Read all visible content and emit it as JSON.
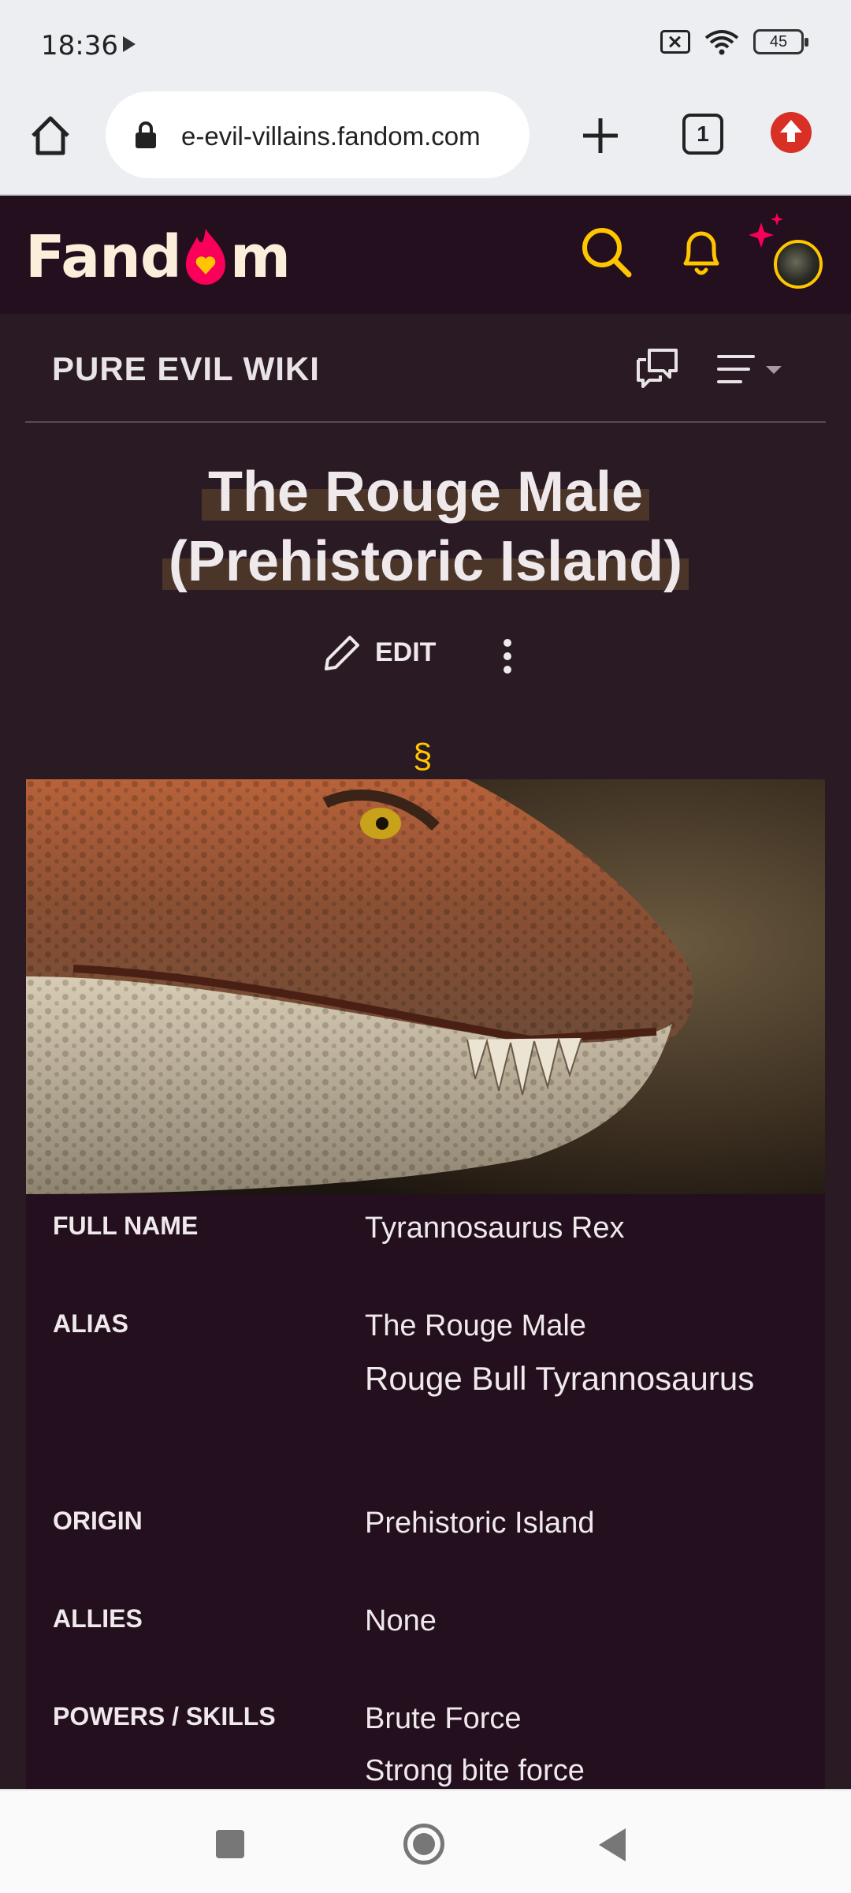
{
  "status_bar": {
    "time": "18:36",
    "battery": "45"
  },
  "browser": {
    "url": "e-evil-villains.fandom.com",
    "tab_count": "1"
  },
  "header": {
    "logo_text_left": "Fand",
    "logo_text_right": "m"
  },
  "wiki": {
    "name": "PURE EVIL WIKI"
  },
  "article": {
    "title_line1": "The Rouge Male",
    "title_line2": "(Prehistoric Island)",
    "edit_label": "EDIT",
    "section_mark": "§"
  },
  "infobox": {
    "image_alt": "Tyrannosaurus close-up",
    "rows": [
      {
        "label": "FULL NAME",
        "values": [
          "Tyrannosaurus Rex"
        ]
      },
      {
        "label": "ALIAS",
        "values": [
          "The Rouge Male",
          "Rouge Bull Tyrannosaurus"
        ]
      },
      {
        "label": "ORIGIN",
        "values": [
          "Prehistoric Island"
        ]
      },
      {
        "label": "ALLIES",
        "values": [
          "None"
        ]
      },
      {
        "label": "POWERS / SKILLS",
        "values": [
          "Brute Force",
          "Strong bite force"
        ]
      }
    ]
  },
  "colors": {
    "accent": "#ffc500",
    "brand_pink": "#fa005a",
    "background": "#2a1a24",
    "header": "#230f1e"
  },
  "icons": [
    "home-icon",
    "lock-icon",
    "plus-icon",
    "tabs-icon",
    "update-icon",
    "search-icon",
    "bell-icon",
    "discussion-icon",
    "menu-icon",
    "edit-icon",
    "more-icon"
  ]
}
